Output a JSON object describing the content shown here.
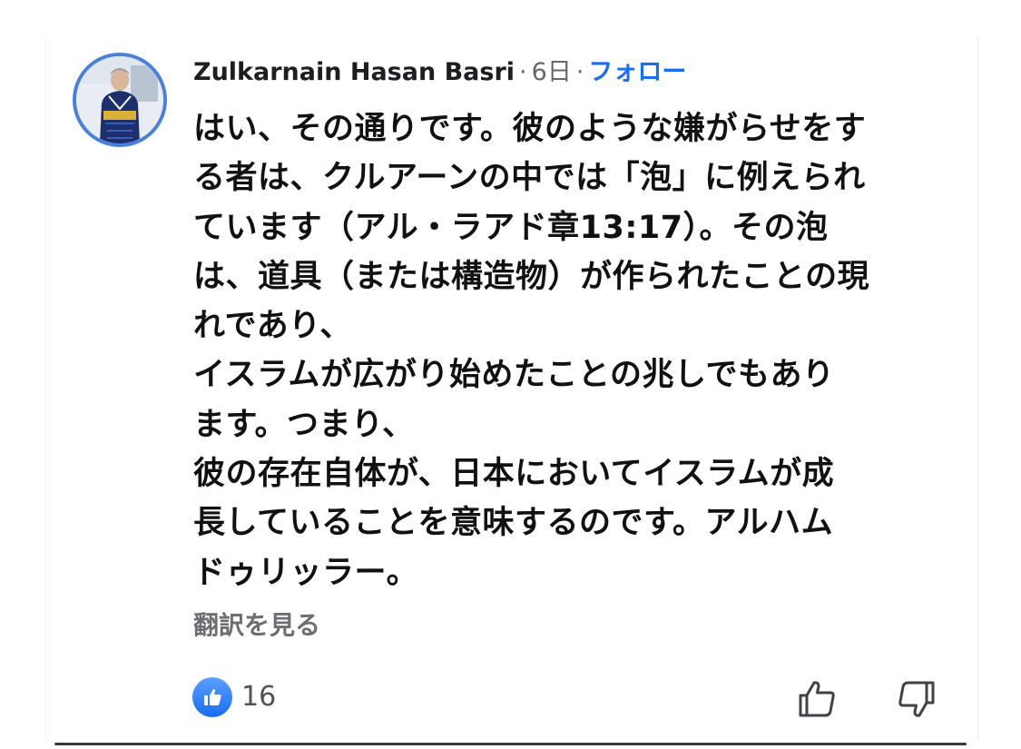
{
  "comment": {
    "author": "Zulkarnain Hasan Basri",
    "separator": "·",
    "time": "6日",
    "follow_label": "フォロー",
    "body_lines": [
      "はい、その通りです。彼のような嫌がらせをす",
      "る者は、クルアーンの中では「泡」に例えられ",
      "ています（アル・ラアド章13:17）。その泡",
      "は、道具（または構造物）が作られたことの現",
      "れであり、",
      "イスラムが広がり始めたことの兆しでもあり",
      "ます。つまり、",
      "彼の存在自体が、日本においてイスラムが成",
      "長していることを意味するのです。アルハム",
      "ドゥリッラー。"
    ],
    "translate_label": "翻訳を見る",
    "like_count": "16"
  },
  "icons": {
    "like_badge": "thumbs-up-icon",
    "upvote": "thumbs-up-outline-icon",
    "downvote": "thumbs-down-outline-icon"
  },
  "colors": {
    "accent": "#1a6cf0",
    "avatar_ring": "#4a80d8",
    "muted_text": "#65676b"
  }
}
